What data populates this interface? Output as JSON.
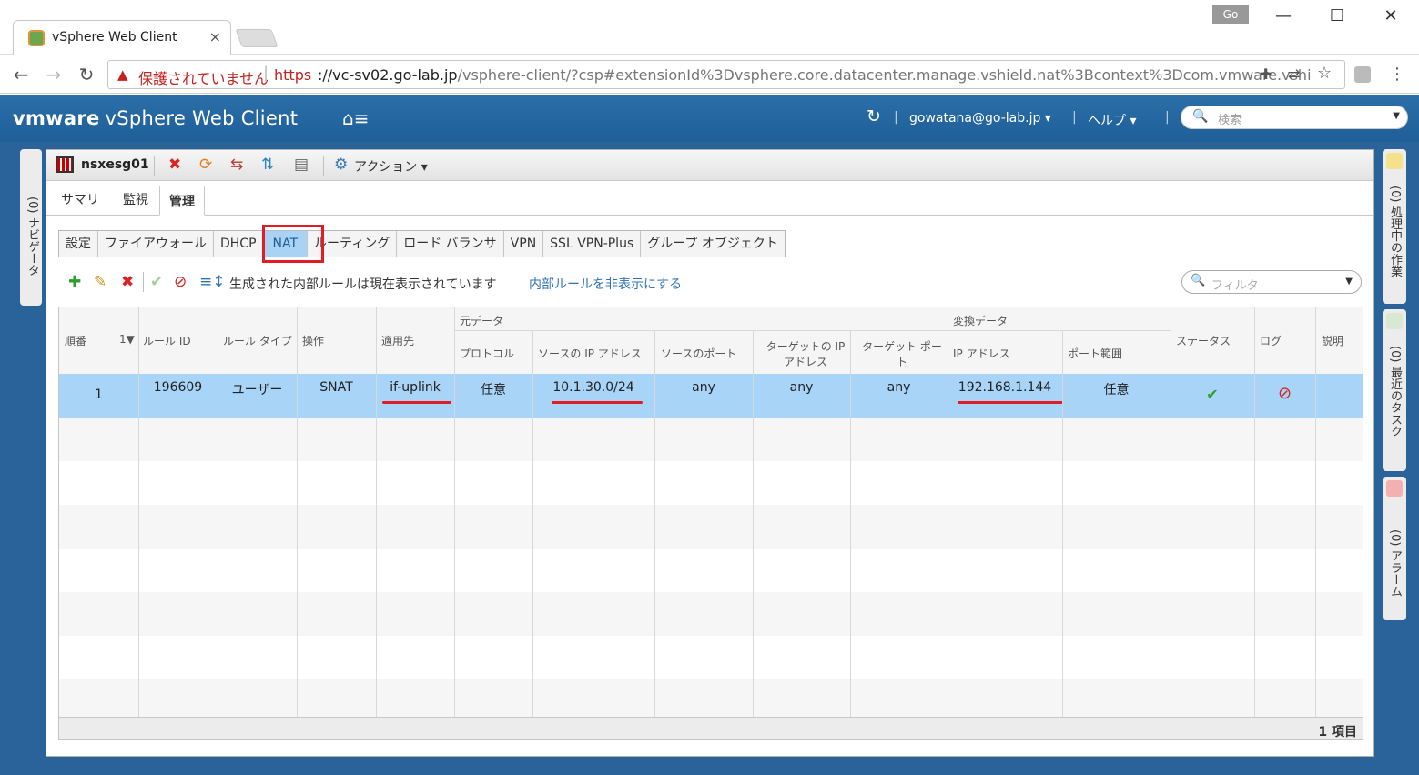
{
  "browser": {
    "tab_title": "vSphere Web Client",
    "tab_close": "×",
    "user_badge": "Go",
    "win_minimize": "—",
    "win_maximize": "☐",
    "win_close": "✕",
    "back": "←",
    "forward": "→",
    "reload": "↻",
    "warning_icon": "▲",
    "insecure_label": "保護されていません",
    "url_scheme": "https",
    "url_host": "://vc-sv02.go-lab.jp",
    "url_path": "/vsphere-client/?csp#extensionId%3Dvsphere.core.datacenter.manage.vshield.nat%3Bcontext%3Dcom.vmware.vshi",
    "bookmark_star": "☆",
    "menu_dots": "⋮"
  },
  "vsphere": {
    "brand_vm": "vmware",
    "brand_product": "vSphere Web Client",
    "home_icon": "⌂≡",
    "refresh_icon": "↻",
    "user": "gowatana@go-lab.jp ▾",
    "help": "ヘルプ ▾",
    "search_placeholder": "検索",
    "search_icon": "🔍",
    "dropdown": "▼"
  },
  "sidebars": {
    "navigator": "(0) ナビゲータ",
    "running_tasks": "(0) 処理中の作業",
    "recent_tasks": "(0) 最近のタスク",
    "alarms": "(0) アラーム"
  },
  "object": {
    "name": "nsxesg01",
    "actions_label": "アクション ▾"
  },
  "main_tabs": [
    "サマリ",
    "監視",
    "管理"
  ],
  "sub_tabs": [
    "設定",
    "ファイアウォール",
    "DHCP",
    "NAT",
    "ルーティング",
    "ロード バランサ",
    "VPN",
    "SSL VPN-Plus",
    "グループ オブジェクト"
  ],
  "rule_bar": {
    "status_text": "生成された内部ルールは現在表示されています",
    "toggle_link": "内部ルールを非表示にする",
    "filter_placeholder": "フィルタ"
  },
  "grid": {
    "group_original": "元データ",
    "group_translated": "変換データ",
    "headers": {
      "order": "順番",
      "sort": "1▼",
      "rule_id": "ルール ID",
      "rule_type": "ルール タイプ",
      "action": "操作",
      "applied_on": "適用先",
      "protocol": "プロトコル",
      "src_ip": "ソースの IP アドレス",
      "src_port": "ソースのポート",
      "dst_ip_1": "ターゲットの IP",
      "dst_ip_2": "アドレス",
      "dst_port_1": "ターゲット ポー",
      "dst_port_2": "ト",
      "ip_address": "IP アドレス",
      "port_range": "ポート範囲",
      "status": "ステータス",
      "log": "ログ",
      "description": "説明"
    },
    "rows": [
      {
        "order": "1",
        "rule_id": "196609",
        "rule_type": "ユーザー",
        "action": "SNAT",
        "applied_on": "if-uplink",
        "protocol": "任意",
        "src_ip": "10.1.30.0/24",
        "src_port": "any",
        "dst_ip": "any",
        "dst_port": "any",
        "translated_ip": "192.168.1.144",
        "port_range": "任意",
        "status_icon": "✔",
        "log_icon": "⊘",
        "description": ""
      }
    ],
    "item_count": "1 項目"
  }
}
